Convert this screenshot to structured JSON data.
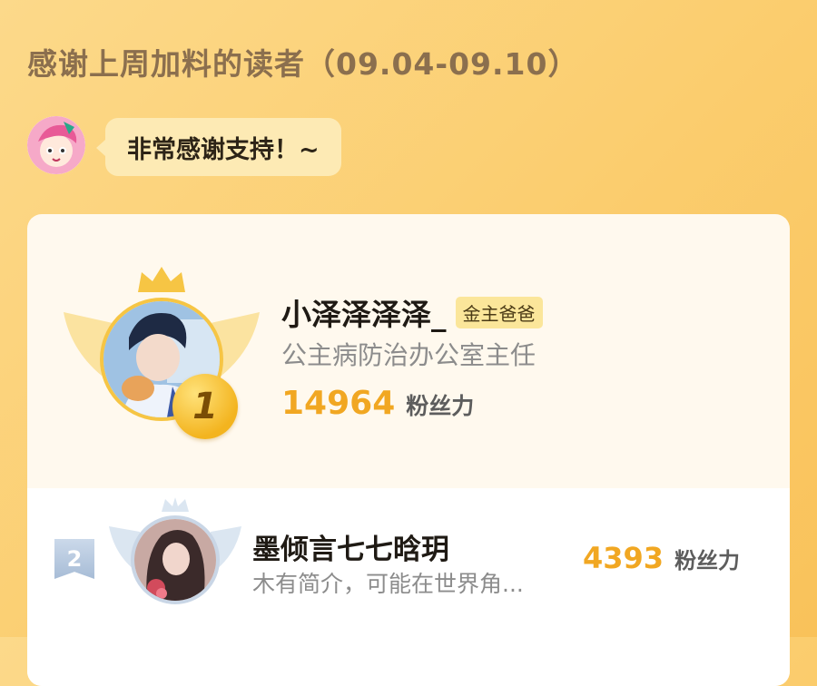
{
  "page": {
    "title": "感谢上周加料的读者（09.04-09.10）"
  },
  "host": {
    "message": "非常感谢支持！~"
  },
  "colors": {
    "accent": "#f1a722",
    "background": "#fbcd6e",
    "badge": "#fbe69a",
    "gold": "#f6c544",
    "silver": "#c9d6e6"
  },
  "leaderboard": [
    {
      "rank": "1",
      "name": "小泽泽泽泽_",
      "badge": "金主爸爸",
      "intro": "公主病防治办公室主任",
      "fans": "14964",
      "fans_label": "粉丝力"
    },
    {
      "rank": "2",
      "name": "墨倾言七七晗玥",
      "intro": "木有简介，可能在世界角...",
      "fans": "4393",
      "fans_label": "粉丝力"
    }
  ],
  "icons": [
    "host-avatar-icon",
    "crown-icon",
    "wings-icon",
    "gold-medal-icon",
    "rank-2-tag-icon"
  ]
}
